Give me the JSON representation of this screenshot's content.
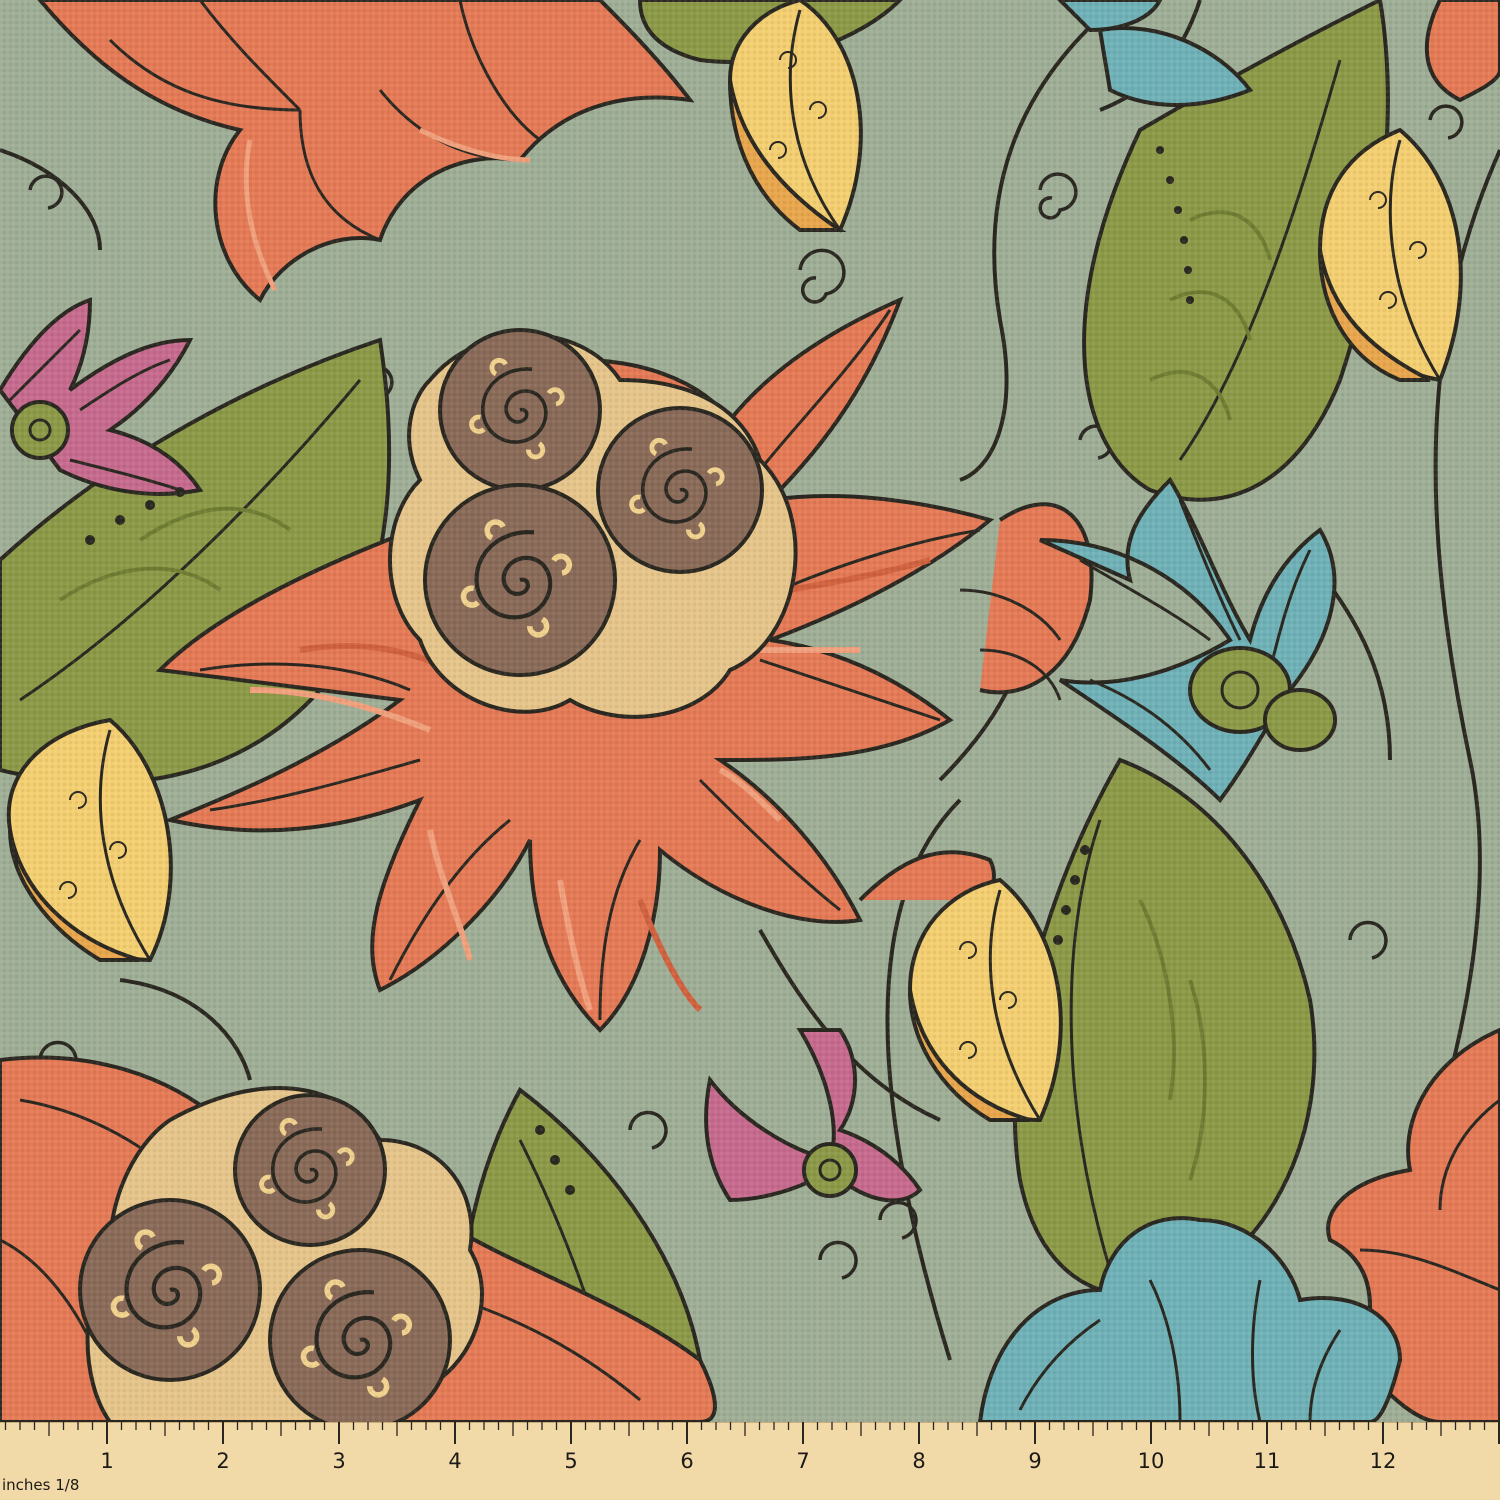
{
  "colors": {
    "background": "#9fae96",
    "coral": "#e57a57",
    "coral_dark": "#d0623f",
    "coral_light": "#f0a07c",
    "brown": "#8a6a58",
    "brown_light": "#b39077",
    "tan": "#e6c58b",
    "olive": "#8c9a48",
    "olive_dark": "#6f7d33",
    "yellow": "#f3cf72",
    "yellow_dark": "#e8a64d",
    "blue": "#6fb1b7",
    "pink": "#c66a8e",
    "ink": "#2a2820",
    "ruler": "#f2d9a8"
  },
  "ruler": {
    "unit_label": "inches 1/8",
    "numbers": [
      "1",
      "2",
      "3",
      "4",
      "5",
      "6",
      "7",
      "8",
      "9",
      "10",
      "11",
      "12",
      "1"
    ]
  }
}
